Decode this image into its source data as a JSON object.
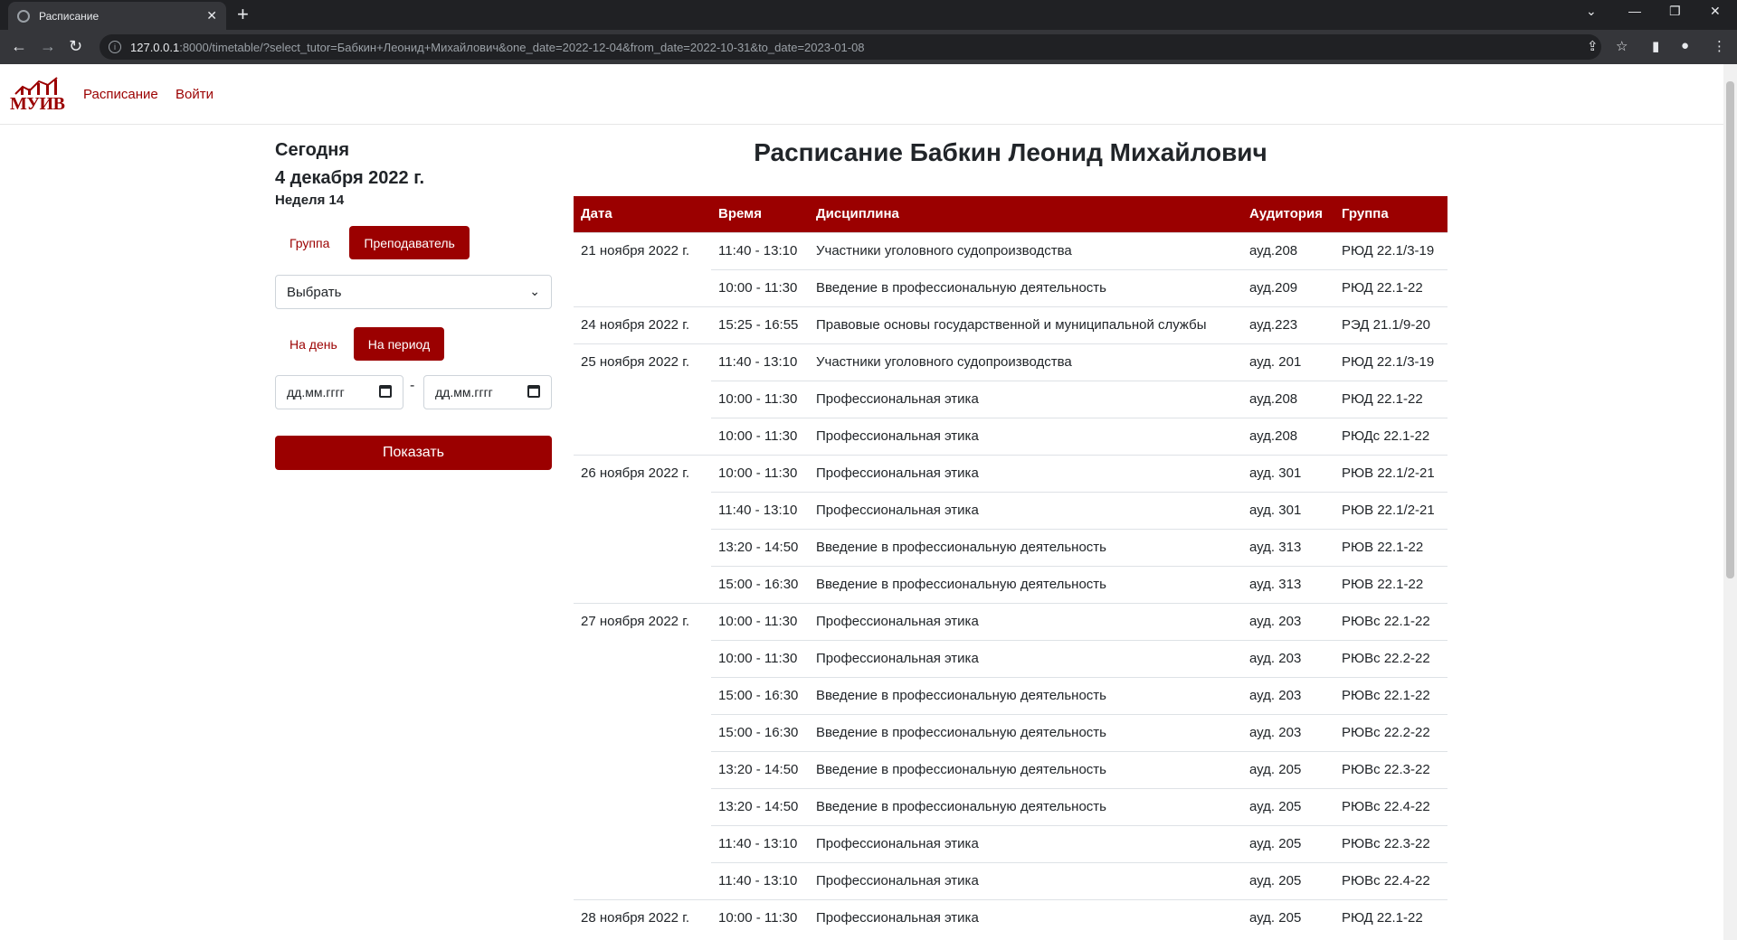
{
  "browser": {
    "tab_title": "Расписание",
    "url_host": "127.0.0.1",
    "url_path": ":8000/timetable/?select_tutor=Бабкин+Леонид+Михайлович&one_date=2022-12-04&from_date=2022-10-31&to_date=2023-01-08"
  },
  "nav": {
    "logo_text": "МУИВ",
    "links": [
      "Расписание",
      "Войти"
    ]
  },
  "sidebar": {
    "today_label": "Сегодня",
    "today_date": "4 декабря 2022 г.",
    "week": "Неделя 14",
    "mode_buttons": [
      "Группа",
      "Преподаватель"
    ],
    "select_value": "Выбрать",
    "period_buttons": [
      "На день",
      "На период"
    ],
    "date_from_placeholder": "дд.мм.гггг",
    "date_to_placeholder": "дд.мм.гггг",
    "date_separator": "-",
    "show_button": "Показать"
  },
  "main": {
    "title": "Расписание Бабкин Леонид Михайлович",
    "columns": [
      "Дата",
      "Время",
      "Дисциплина",
      "Аудитория",
      "Группа"
    ],
    "rows": [
      [
        "21 ноября 2022 г.",
        "11:40 - 13:10",
        "Участники уголовного судопроизводства",
        "ауд.208",
        "РЮД 22.1/3-19"
      ],
      [
        "",
        "10:00 - 11:30",
        "Введение в профессиональную деятельность",
        "ауд.209",
        "РЮД 22.1-22"
      ],
      [
        "24 ноября 2022 г.",
        "15:25 - 16:55",
        "Правовые основы государственной и муниципальной службы",
        "ауд.223",
        "РЭД 21.1/9-20"
      ],
      [
        "25 ноября 2022 г.",
        "11:40 - 13:10",
        "Участники уголовного судопроизводства",
        "ауд. 201",
        "РЮД 22.1/3-19"
      ],
      [
        "",
        "10:00 - 11:30",
        "Профессиональная этика",
        "ауд.208",
        "РЮД 22.1-22"
      ],
      [
        "",
        "10:00 - 11:30",
        "Профессиональная этика",
        "ауд.208",
        "РЮДс 22.1-22"
      ],
      [
        "26 ноября 2022 г.",
        "10:00 - 11:30",
        "Профессиональная этика",
        "ауд. 301",
        "РЮВ 22.1/2-21"
      ],
      [
        "",
        "11:40 - 13:10",
        "Профессиональная этика",
        "ауд. 301",
        "РЮВ 22.1/2-21"
      ],
      [
        "",
        "13:20 - 14:50",
        "Введение в профессиональную деятельность",
        "ауд. 313",
        "РЮВ 22.1-22"
      ],
      [
        "",
        "15:00 - 16:30",
        "Введение в профессиональную деятельность",
        "ауд. 313",
        "РЮВ 22.1-22"
      ],
      [
        "27 ноября 2022 г.",
        "10:00 - 11:30",
        "Профессиональная этика",
        "ауд. 203",
        "РЮВс 22.1-22"
      ],
      [
        "",
        "10:00 - 11:30",
        "Профессиональная этика",
        "ауд. 203",
        "РЮВс 22.2-22"
      ],
      [
        "",
        "15:00 - 16:30",
        "Введение в профессиональную деятельность",
        "ауд. 203",
        "РЮВс 22.1-22"
      ],
      [
        "",
        "15:00 - 16:30",
        "Введение в профессиональную деятельность",
        "ауд. 203",
        "РЮВс 22.2-22"
      ],
      [
        "",
        "13:20 - 14:50",
        "Введение в профессиональную деятельность",
        "ауд. 205",
        "РЮВс 22.3-22"
      ],
      [
        "",
        "13:20 - 14:50",
        "Введение в профессиональную деятельность",
        "ауд. 205",
        "РЮВс 22.4-22"
      ],
      [
        "",
        "11:40 - 13:10",
        "Профессиональная этика",
        "ауд. 205",
        "РЮВс 22.3-22"
      ],
      [
        "",
        "11:40 - 13:10",
        "Профессиональная этика",
        "ауд. 205",
        "РЮВс 22.4-22"
      ],
      [
        "28 ноября 2022 г.",
        "10:00 - 11:30",
        "Профессиональная этика",
        "ауд. 205",
        "РЮД 22.1-22"
      ]
    ]
  },
  "colors": {
    "brand": "#9b0000"
  }
}
